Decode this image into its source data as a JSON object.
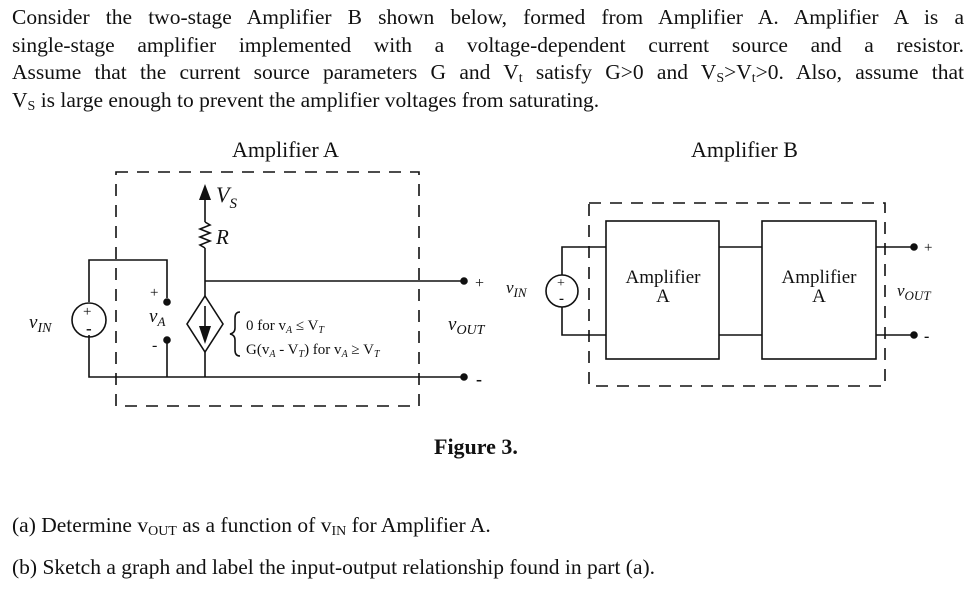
{
  "problem_statement": {
    "lines": [
      "Consider the two-stage Amplifier B shown below, formed from Amplifier A. Amplifier A is a",
      "single-stage amplifier implemented with a voltage-dependent current source and a resistor.",
      "Assume that the current source parameters G and V",
      "is large enough to prevent the amplifier voltages from saturating."
    ],
    "line3_sub_t": "t",
    "line3_rest": " satisfy G>0 and V",
    "line3_sub_s": "S",
    "line3_gt": ">V",
    "line3_sub_t2": "t",
    "line3_end": ">0. Also, assume that",
    "line4_prefix": "V",
    "line4_sub": "S"
  },
  "figure": {
    "amp_a_title": "Amplifier A",
    "amp_b_title": "Amplifier B",
    "caption": "Figure 3.",
    "amp_a": {
      "supply_label": "V",
      "supply_sub": "S",
      "resistor_label": "R",
      "input_label": "v",
      "input_sub": "IN",
      "va_label": "v",
      "va_sub": "A",
      "plus": "+",
      "minus": "-",
      "output_label": "v",
      "output_sub": "OUT",
      "piecewise": [
        {
          "expr": "0 for v",
          "sub": "A",
          "rel": " ≤ V",
          "sub2": "T"
        },
        {
          "expr": "G(v",
          "sub": "A",
          "mid": " - V",
          "sub2": "T",
          "rel": ") for v",
          "sub3": "A",
          "rel2": " ≥ V",
          "sub4": "T"
        }
      ]
    },
    "amp_b": {
      "input_label": "v",
      "input_sub": "IN",
      "stage_label_line1": "Amplifier",
      "stage_label_line2": "A",
      "output_label": "v",
      "output_sub": "OUT",
      "plus": "+",
      "minus": "-"
    }
  },
  "questions": [
    {
      "prefix": "(a) Determine v",
      "sub1": "OUT",
      "mid": " as a function of v",
      "sub2": "IN",
      "suffix": " for Amplifier A."
    },
    {
      "text": "(b) Sketch a graph and label the input-output relationship found in part (a)."
    }
  ]
}
